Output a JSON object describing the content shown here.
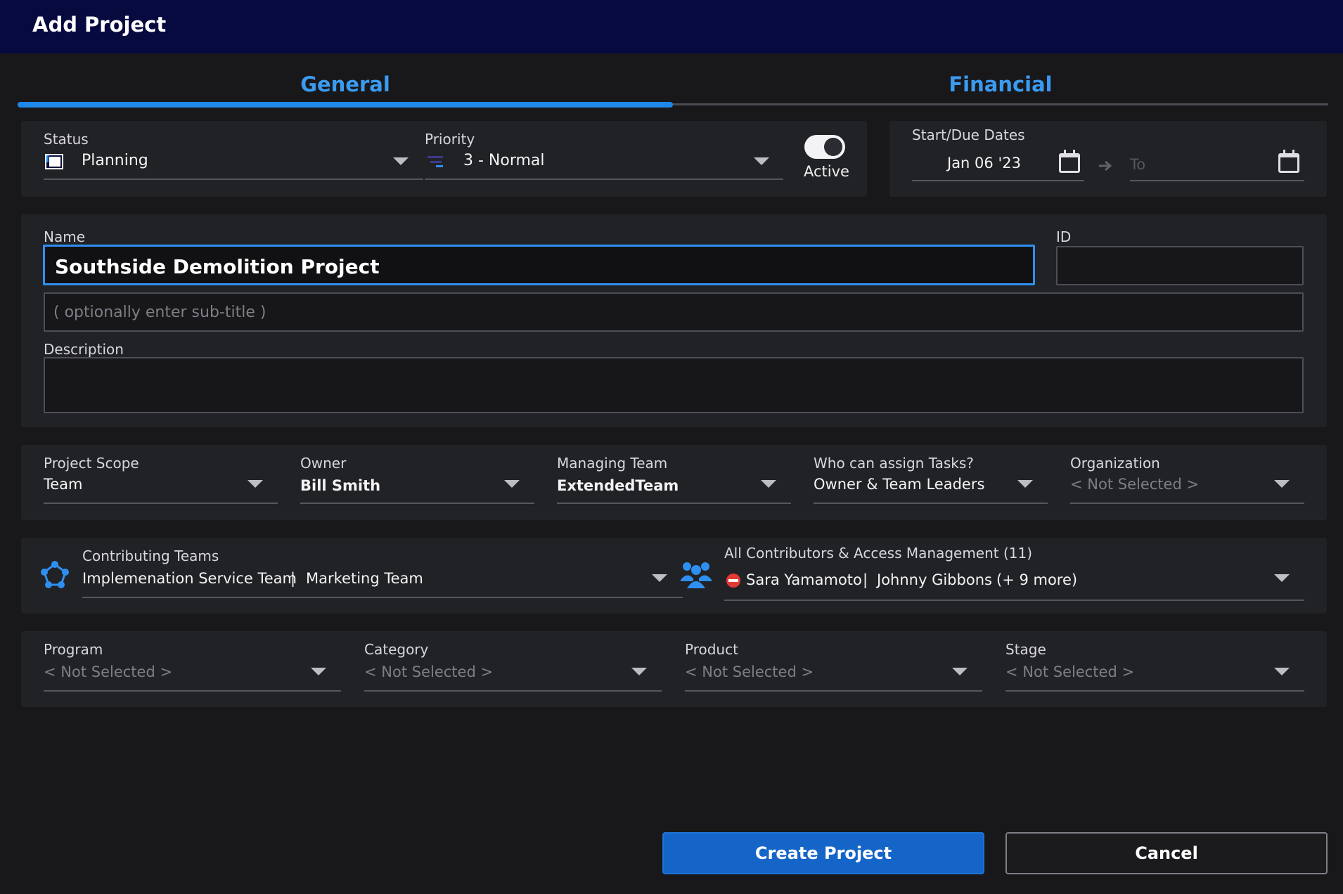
{
  "window": {
    "title": "Add Project"
  },
  "tabs": [
    {
      "label": "General"
    },
    {
      "label": "Financial"
    }
  ],
  "status": {
    "label": "Status",
    "value": "Planning"
  },
  "priority": {
    "label": "Priority",
    "value": "3 - Normal"
  },
  "active_toggle": {
    "label": "Active",
    "on": true
  },
  "dates": {
    "label": "Start/Due Dates",
    "start": "Jan 06 '23",
    "end_placeholder": "To"
  },
  "name": {
    "label": "Name",
    "value": "Southside Demolition Project",
    "subtitle_placeholder": "( optionally enter sub-title )"
  },
  "id_field": {
    "label": "ID",
    "value": ""
  },
  "description": {
    "label": "Description",
    "value": ""
  },
  "row1": {
    "project_scope": {
      "label": "Project Scope",
      "value": "Team"
    },
    "owner": {
      "label": "Owner",
      "value": "Bill Smith"
    },
    "managing_team": {
      "label": "Managing Team",
      "value": "ExtendedTeam"
    },
    "assign_tasks": {
      "label": "Who can assign Tasks?",
      "value": "Owner & Team Leaders"
    },
    "organization": {
      "label": "Organization",
      "value": "< Not Selected >"
    }
  },
  "contributing_teams": {
    "label": "Contributing Teams",
    "team1": "Implemenation Service Team",
    "separator": "|",
    "team2": "Marketing Team"
  },
  "contributors": {
    "label": "All Contributors & Access Management (11)",
    "person1": "Sara Yamamoto",
    "separator": "|",
    "person2": "Johnny Gibbons",
    "more": "(+ 9 more)"
  },
  "row3": {
    "program": {
      "label": "Program",
      "value": "< Not Selected >"
    },
    "category": {
      "label": "Category",
      "value": "< Not Selected >"
    },
    "product": {
      "label": "Product",
      "value": "< Not Selected >"
    },
    "stage": {
      "label": "Stage",
      "value": "< Not Selected >"
    }
  },
  "buttons": {
    "create": "Create Project",
    "cancel": "Cancel"
  },
  "colors": {
    "accent": "#1f86ea",
    "title_bar": "#070a3f",
    "primary_button": "#1565c8",
    "panel": "#212226",
    "background": "#18181b"
  },
  "icons": {
    "status": "planning-flag-icon",
    "priority": "priority-bars-icon",
    "calendar": "calendar-icon",
    "arrow": "arrow-right-icon",
    "teams": "team-network-icon",
    "contributors": "people-group-icon",
    "blocked": "no-entry-icon"
  }
}
